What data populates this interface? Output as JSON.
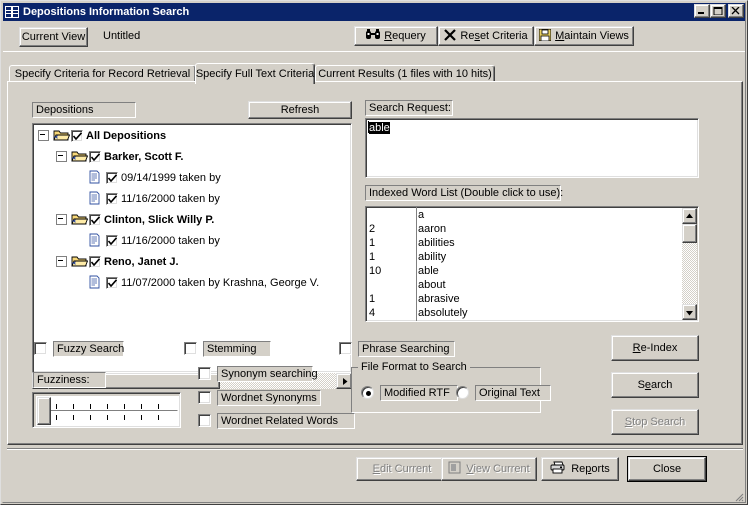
{
  "window": {
    "title": "Depositions Information Search",
    "icon": "table-grid-icon",
    "controls": [
      {
        "name": "minimize",
        "glyph": "_"
      },
      {
        "name": "maximize",
        "glyph": "□"
      },
      {
        "name": "close",
        "glyph": "✕"
      }
    ]
  },
  "toolbar": {
    "current_view_label": "Current View",
    "view_name": "Untitled",
    "requery_label": "Requery",
    "requery_icon": "binoculars-icon",
    "reset_label": "Reset Criteria",
    "reset_icon": "x-mark-icon",
    "maintain_label": "Maintain Views",
    "maintain_icon": "floppy-disk-icon"
  },
  "tabs": [
    {
      "label": "Specify Criteria for Record Retrieval",
      "selected": false
    },
    {
      "label": "Specify Full Text Criteria",
      "selected": true
    },
    {
      "label": "Current Results (1 files with 10 hits)",
      "selected": false
    }
  ],
  "tree_panel": {
    "label": "Depositions",
    "refresh_label": "Refresh",
    "items": [
      {
        "label": "All Depositions",
        "indent": 0,
        "kind": "folder",
        "checked": true,
        "bold": true,
        "expanded": true
      },
      {
        "label": "Barker, Scott F.",
        "indent": 1,
        "kind": "folder",
        "checked": true,
        "bold": true,
        "expanded": true
      },
      {
        "label": "09/14/1999 taken by",
        "indent": 2,
        "kind": "doc",
        "checked": true,
        "bold": false,
        "expanded": false
      },
      {
        "label": "11/16/2000 taken by",
        "indent": 2,
        "kind": "doc",
        "checked": true,
        "bold": false,
        "expanded": false
      },
      {
        "label": "Clinton, Slick Willy P.",
        "indent": 1,
        "kind": "folder",
        "checked": true,
        "bold": true,
        "expanded": true
      },
      {
        "label": "11/16/2000 taken by",
        "indent": 2,
        "kind": "doc",
        "checked": true,
        "bold": false,
        "expanded": false
      },
      {
        "label": "Reno, Janet J.",
        "indent": 1,
        "kind": "folder",
        "checked": true,
        "bold": true,
        "expanded": true
      },
      {
        "label": "11/07/2000 taken by Krashna, George V.",
        "indent": 2,
        "kind": "doc",
        "checked": true,
        "bold": false,
        "expanded": false
      }
    ]
  },
  "search_request": {
    "label": "Search Request:",
    "value": "able",
    "selected": true
  },
  "word_list": {
    "label": "Indexed Word List (Double click to use):",
    "rows": [
      {
        "count": "",
        "term": "a"
      },
      {
        "count": "2",
        "term": "aaron"
      },
      {
        "count": "1",
        "term": "abilities"
      },
      {
        "count": "1",
        "term": "ability"
      },
      {
        "count": "10",
        "term": "able"
      },
      {
        "count": "",
        "term": "about"
      },
      {
        "count": "1",
        "term": "abrasive"
      },
      {
        "count": "4",
        "term": "absolutely"
      }
    ]
  },
  "options": {
    "fuzzy_search": {
      "label": "Fuzzy Search",
      "checked": false
    },
    "fuzziness_label": "Fuzziness:",
    "stemming": {
      "label": "Stemming",
      "checked": false
    },
    "synonym_searching": {
      "label": "Synonym searching",
      "checked": false
    },
    "wordnet_synonyms": {
      "label": "Wordnet Synonyms",
      "checked": false
    },
    "wordnet_related": {
      "label": "Wordnet Related Words",
      "checked": false
    },
    "phrase_searching": {
      "label": "Phrase Searching",
      "checked": false
    },
    "file_format": {
      "legend": "File Format to Search",
      "options": [
        {
          "label": "Modified RTF",
          "selected": true
        },
        {
          "label": "Original Text",
          "selected": false
        }
      ]
    }
  },
  "actions": {
    "reindex": {
      "label": "Re-Index",
      "disabled": false
    },
    "search": {
      "label": "Search",
      "disabled": false
    },
    "stop_search": {
      "label": "Stop Search",
      "disabled": true
    }
  },
  "footer": {
    "edit_current": {
      "label": "Edit Current",
      "disabled": true
    },
    "view_current": {
      "label": "View Current",
      "disabled": true,
      "icon": "document-view-icon"
    },
    "reports": {
      "label": "Reports",
      "disabled": false,
      "icon": "printer-icon"
    },
    "close": {
      "label": "Close",
      "disabled": false
    }
  },
  "colors": {
    "titlebar": "#0a246a",
    "face": "#d4d0c8",
    "shadow": "#808080",
    "highlight": "#ffffff",
    "text": "#000000",
    "disabled_text": "#808080",
    "field": "#ffffff",
    "folder": "#f8d878"
  }
}
